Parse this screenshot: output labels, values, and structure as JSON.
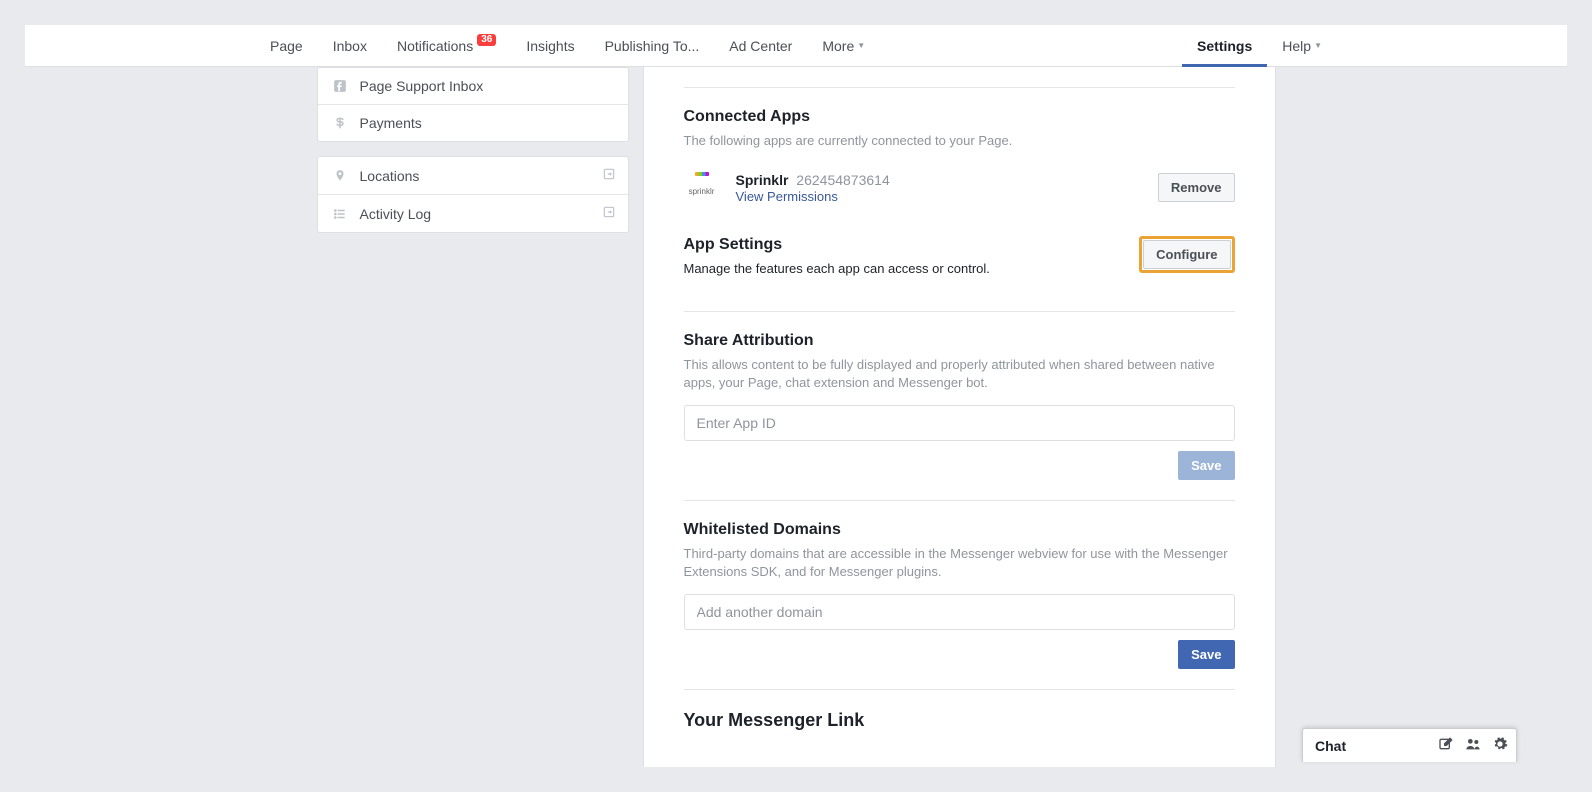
{
  "nav": {
    "left": [
      {
        "label": "Page"
      },
      {
        "label": "Inbox"
      },
      {
        "label": "Notifications",
        "badge": "36"
      },
      {
        "label": "Insights"
      },
      {
        "label": "Publishing To..."
      },
      {
        "label": "Ad Center"
      },
      {
        "label": "More",
        "dropdown": true
      }
    ],
    "right": [
      {
        "label": "Settings",
        "active": true
      },
      {
        "label": "Help",
        "dropdown": true
      }
    ]
  },
  "sidebar": {
    "group1": [
      {
        "icon": "facebook",
        "label": "Page Support Inbox"
      },
      {
        "icon": "dollar",
        "label": "Payments"
      }
    ],
    "group2": [
      {
        "icon": "pin",
        "label": "Locations",
        "trailing": true
      },
      {
        "icon": "list",
        "label": "Activity Log",
        "trailing": true
      }
    ]
  },
  "connectedApps": {
    "title": "Connected Apps",
    "subtitle": "The following apps are currently connected to your Page.",
    "apps": [
      {
        "logoText": "sprinklr",
        "name": "Sprinklr",
        "id": "262454873614",
        "permissionsLink": "View Permissions",
        "removeLabel": "Remove"
      }
    ]
  },
  "appSettings": {
    "title": "App Settings",
    "subtitle": "Manage the features each app can access or control.",
    "configureLabel": "Configure"
  },
  "shareAttribution": {
    "title": "Share Attribution",
    "subtitle": "This allows content to be fully displayed and properly attributed when shared between native apps, your Page, chat extension and Messenger bot.",
    "placeholder": "Enter App ID",
    "saveLabel": "Save"
  },
  "whitelistedDomains": {
    "title": "Whitelisted Domains",
    "subtitle": "Third-party domains that are accessible in the Messenger webview for use with the Messenger Extensions SDK, and for Messenger plugins.",
    "placeholder": "Add another domain",
    "saveLabel": "Save"
  },
  "messengerLink": {
    "title": "Your Messenger Link"
  },
  "chat": {
    "title": "Chat"
  }
}
